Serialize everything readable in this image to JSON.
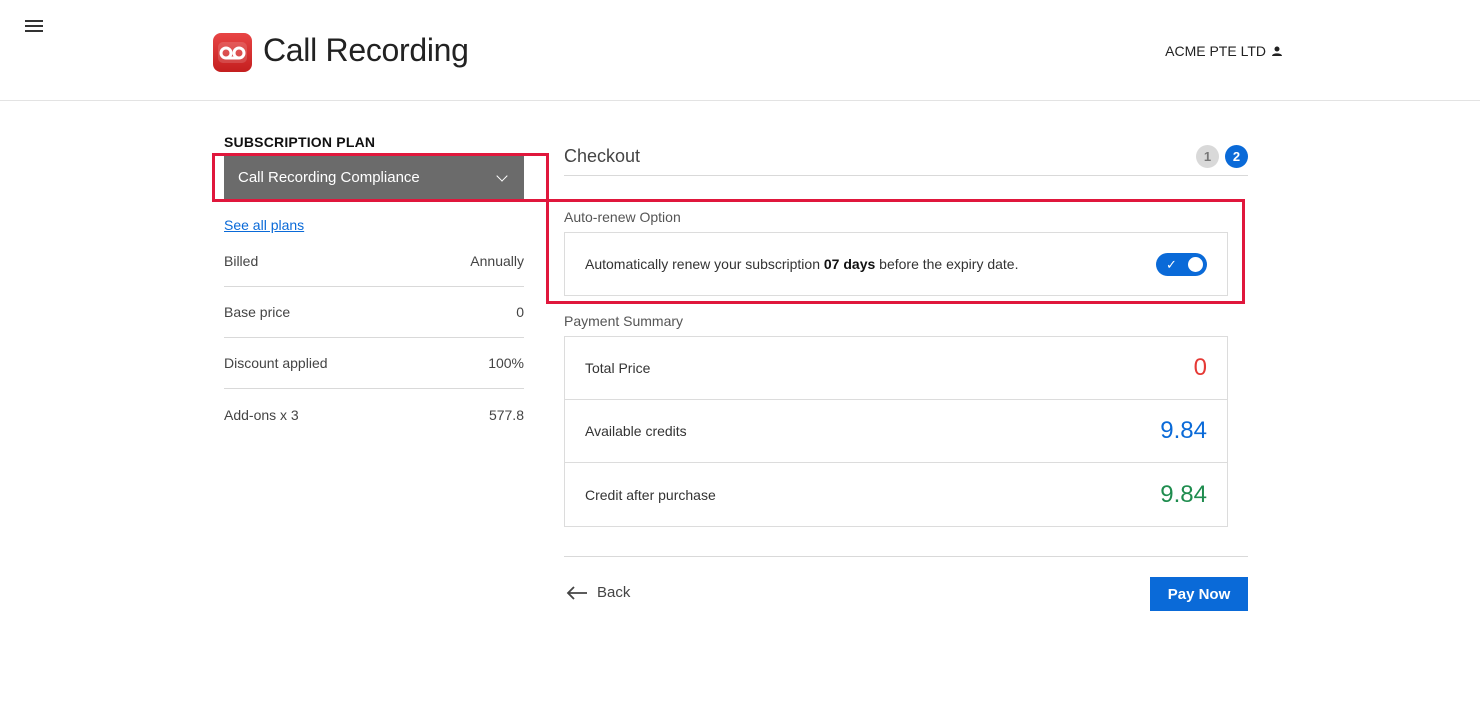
{
  "header": {
    "menu_icon": "hamburger-menu-icon",
    "app_icon": "voicemail-icon",
    "app_title": "Call Recording",
    "company": "ACME PTE LTD",
    "user_icon": "person-icon"
  },
  "plan": {
    "heading": "SUBSCRIPTION PLAN",
    "selected": "Call Recording Compliance",
    "see_all": "See all plans",
    "rows": [
      {
        "label": "Billed",
        "value": "Annually"
      },
      {
        "label": "Base price",
        "value": "0"
      },
      {
        "label": "Discount applied",
        "value": "100%"
      },
      {
        "label": "Add-ons x 3",
        "value": "577.8"
      }
    ]
  },
  "checkout": {
    "title": "Checkout",
    "steps": [
      "1",
      "2"
    ],
    "active_step": "2"
  },
  "auto_renew": {
    "label": "Auto-renew Option",
    "text_before": "Automatically renew your subscription ",
    "text_bold": "07 days",
    "text_after": " before the expiry date.",
    "toggle_check": "✓",
    "enabled": true
  },
  "payment": {
    "label": "Payment Summary",
    "rows": [
      {
        "label": "Total Price",
        "value": "0"
      },
      {
        "label": "Available credits",
        "value": "9.84"
      },
      {
        "label": "Credit after purchase",
        "value": "9.84"
      }
    ]
  },
  "actions": {
    "back": "Back",
    "pay": "Pay Now"
  },
  "colors": {
    "accent": "#0a6ad8",
    "highlight": "#e0173c",
    "total_price": "#e53935",
    "credits": "#0a6ad8",
    "credit_after": "#1e8c4e"
  }
}
